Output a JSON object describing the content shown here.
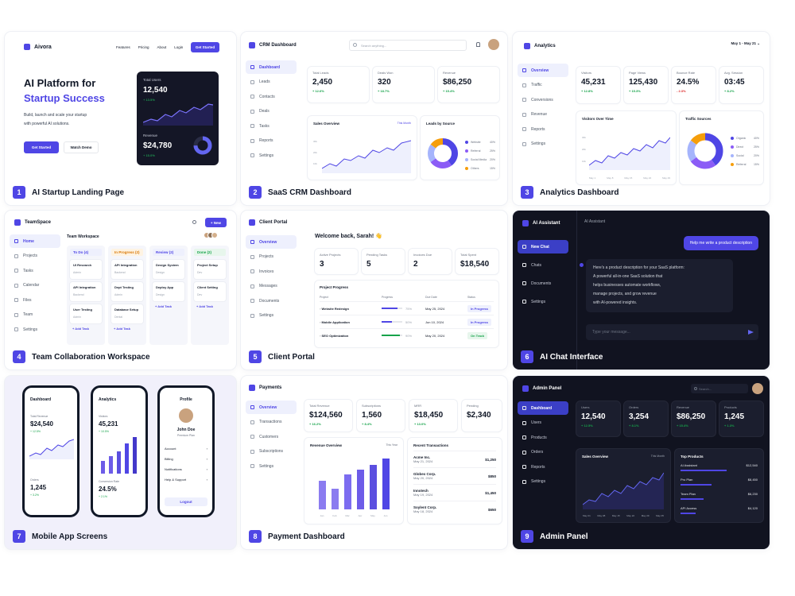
{
  "colors": {
    "accent": "#4f46e5",
    "green": "#16a34a",
    "red": "#dc2626",
    "dark_bg": "#111320"
  },
  "card1": {
    "caption_num": "1",
    "caption": "AI Startup Landing Page",
    "brand": "Aivora",
    "nav": [
      "Features",
      "Pricing",
      "About",
      "Login"
    ],
    "nav_cta": "Get Started",
    "hero_line1": "AI Platform for",
    "hero_line2": "Startup Success",
    "sub1": "Build, launch and scale your startup",
    "sub2": "with powerful AI solutions.",
    "cta_primary": "Get Started",
    "cta_secondary": "Watch Demo",
    "widget": {
      "users_label": "Total Users",
      "users_value": "12,540",
      "users_delta": "+ 13.5%",
      "rev_label": "Revenue",
      "rev_value": "$24,780",
      "rev_delta": "+ 15.0%"
    }
  },
  "card2": {
    "caption_num": "2",
    "caption": "SaaS CRM Dashboard",
    "title": "CRM Dashboard",
    "search_placeholder": "Search anything...",
    "nav": [
      "Dashboard",
      "Leads",
      "Contacts",
      "Deals",
      "Tasks",
      "Reports",
      "Settings"
    ],
    "stats": [
      {
        "label": "Total Leads",
        "value": "2,450",
        "delta": "+ 12.6%"
      },
      {
        "label": "Deals Won",
        "value": "320",
        "delta": "+ 18.7%"
      },
      {
        "label": "Revenue",
        "value": "$86,250",
        "delta": "+ 15.4%"
      }
    ],
    "sales_title": "Sales Overview",
    "sales_period": "This Month",
    "sales_y": [
      "30k",
      "20k",
      "10k"
    ],
    "leads_title": "Leads by Source",
    "legend": [
      {
        "name": "Website",
        "pct": "40%",
        "color": "#4f46e5"
      },
      {
        "name": "Referral",
        "pct": "25%",
        "color": "#8b5cf6"
      },
      {
        "name": "Social Media",
        "pct": "20%",
        "color": "#a5b4fc"
      },
      {
        "name": "Others",
        "pct": "15%",
        "color": "#f59e0b"
      }
    ]
  },
  "card3": {
    "caption_num": "3",
    "caption": "Analytics Dashboard",
    "title": "Analytics",
    "date_range": "May 1 - May 21",
    "nav": [
      "Overview",
      "Traffic",
      "Conversions",
      "Revenue",
      "Reports",
      "Settings"
    ],
    "stats": [
      {
        "label": "Visitors",
        "value": "45,231",
        "delta": "+ 12.8%",
        "neg": false
      },
      {
        "label": "Page Views",
        "value": "125,430",
        "delta": "+ 15.3%",
        "neg": false
      },
      {
        "label": "Bounce Rate",
        "value": "24.5%",
        "delta": "- 2.3%",
        "neg": true
      },
      {
        "label": "Avg. Session",
        "value": "03:45",
        "delta": "+ 8.2%",
        "neg": false
      }
    ],
    "visitors_title": "Visitors Over Time",
    "visitors_y": [
      "30k",
      "20k",
      "10k"
    ],
    "visitors_x": [
      "May 1",
      "May 8",
      "May 15",
      "May 22",
      "May 29"
    ],
    "traffic_title": "Traffic Sources",
    "legend": [
      {
        "name": "Organic",
        "pct": "40%",
        "color": "#4f46e5"
      },
      {
        "name": "Direct",
        "pct": "25%",
        "color": "#8b5cf6"
      },
      {
        "name": "Social",
        "pct": "20%",
        "color": "#a5b4fc"
      },
      {
        "name": "Referral",
        "pct": "15%",
        "color": "#f59e0b"
      }
    ]
  },
  "card4": {
    "caption_num": "4",
    "caption": "Team Collaboration Workspace",
    "brand": "TeamSpace",
    "new_btn": "+ New",
    "workspace_title": "Team Workspace",
    "nav": [
      "Home",
      "Projects",
      "Tasks",
      "Calendar",
      "Files",
      "Team",
      "Settings"
    ],
    "columns": [
      {
        "title": "To Do (4)",
        "color": "#4f46e5",
        "bg": "#eef0fd",
        "tasks": [
          {
            "t": "UI Research",
            "s": "Admin"
          },
          {
            "t": "API Integration",
            "s": "Backend"
          },
          {
            "t": "User Testing",
            "s": "Admin"
          }
        ],
        "add": "+ Add Task"
      },
      {
        "title": "In Progress (2)",
        "color": "#d97706",
        "bg": "#fef3e2",
        "tasks": [
          {
            "t": "API Integration",
            "s": "Backend"
          },
          {
            "t": "Dept Testing",
            "s": "Admin"
          },
          {
            "t": "Database Setup",
            "s": "Dental"
          }
        ],
        "add": "+ Add Task"
      },
      {
        "title": "Review (2)",
        "color": "#4f46e5",
        "bg": "#eef0fd",
        "tasks": [
          {
            "t": "Design System",
            "s": "Design"
          },
          {
            "t": "Deploy App",
            "s": "Design"
          }
        ],
        "add": "+ Add Task"
      },
      {
        "title": "Done (2)",
        "color": "#16a34a",
        "bg": "#e7f6ec",
        "tasks": [
          {
            "t": "Project Setup",
            "s": "Dev"
          },
          {
            "t": "Client Setting",
            "s": "Dev"
          }
        ],
        "add": "+ Add Task"
      }
    ]
  },
  "card5": {
    "caption_num": "5",
    "caption": "Client Portal",
    "brand": "Client Portal",
    "welcome": "Welcome back, Sarah! 👋",
    "nav": [
      "Overview",
      "Projects",
      "Invoices",
      "Messages",
      "Documents",
      "Settings"
    ],
    "stats": [
      {
        "label": "Active Projects",
        "value": "3"
      },
      {
        "label": "Pending Tasks",
        "value": "5"
      },
      {
        "label": "Invoices Due",
        "value": "2"
      },
      {
        "label": "Total Spent",
        "value": "$18,540"
      }
    ],
    "progress_title": "Project Progress",
    "headers": [
      "Project",
      "Progress",
      "Due Date",
      "Status"
    ],
    "rows": [
      {
        "name": "Website Redesign",
        "pct": "75%",
        "pv": 75,
        "due": "May 25, 2024",
        "status": "In Progress",
        "c": "#4f46e5"
      },
      {
        "name": "Mobile Application",
        "pct": "50%",
        "pv": 50,
        "due": "Jun 10, 2024",
        "status": "In Progress",
        "c": "#4f46e5"
      },
      {
        "name": "SEO Optimization",
        "pct": "90%",
        "pv": 90,
        "due": "May 20, 2024",
        "status": "On Track",
        "c": "#16a34a"
      }
    ]
  },
  "card6": {
    "caption_num": "6",
    "caption": "AI Chat Interface",
    "brand": "AI Assistant",
    "header": "AI Assistant",
    "nav": [
      "New Chat",
      "Chats",
      "Documents",
      "Settings"
    ],
    "user_msg": "Help me write a product description",
    "bot_l1": "Here's a product description for your SaaS platform:",
    "bot_l2": "A powerful all-in-one SaaS solution that",
    "bot_l3": "helps businesses automate workflows,",
    "bot_l4": "manage projects, and grow revenue",
    "bot_l5": "with AI-powered insights.",
    "input_placeholder": "Type your message..."
  },
  "card7": {
    "caption_num": "7",
    "caption": "Mobile App Screens",
    "p1": {
      "title": "Dashboard",
      "rev_label": "Total Revenue",
      "rev_value": "$24,540",
      "rev_delta": "+ 12.5%",
      "orders_label": "Orders",
      "orders_value": "1,245",
      "orders_delta": "+ 3.2%"
    },
    "p2": {
      "title": "Analytics",
      "vis_label": "Visitors",
      "vis_value": "45,231",
      "vis_delta": "+ 10.5%",
      "conv_label": "Conversion Rate",
      "conv_value": "24.5%",
      "conv_delta": "+ 2.1%"
    },
    "p3": {
      "title": "Profile",
      "name": "John Doe",
      "role": "Premium Plan",
      "items": [
        "Account",
        "Billing",
        "Notifications",
        "Help & Support"
      ],
      "logout": "Logout"
    }
  },
  "card8": {
    "caption_num": "8",
    "caption": "Payment Dashboard",
    "brand": "Payments",
    "nav": [
      "Overview",
      "Transactions",
      "Customers",
      "Subscriptions",
      "Settings"
    ],
    "stats": [
      {
        "label": "Total Revenue",
        "value": "$124,560",
        "delta": "+ 16.2%"
      },
      {
        "label": "Subscriptions",
        "value": "1,560",
        "delta": "+ 8.4%"
      },
      {
        "label": "MRR",
        "value": "$18,450",
        "delta": "+ 13.0%"
      },
      {
        "label": "Pending",
        "value": "$2,340",
        "delta": ""
      }
    ],
    "rev_title": "Revenue Overview",
    "rev_period": "This Year",
    "months": [
      "Jan",
      "Feb",
      "Mar",
      "Apr",
      "May",
      "Jun"
    ],
    "tx_title": "Recent Transactions",
    "tx": [
      {
        "name": "Acme Inc.",
        "date": "May 21, 2024",
        "amt": "$1,250"
      },
      {
        "name": "Globex Corp.",
        "date": "May 20, 2024",
        "amt": "$850"
      },
      {
        "name": "Innotech",
        "date": "May 19, 2024",
        "amt": "$1,450"
      },
      {
        "name": "Soylent Corp.",
        "date": "May 18, 2024",
        "amt": "$650"
      }
    ]
  },
  "card9": {
    "caption_num": "9",
    "caption": "Admin Panel",
    "brand": "Admin Panel",
    "search_placeholder": "Search...",
    "nav": [
      "Dashboard",
      "Users",
      "Products",
      "Orders",
      "Reports",
      "Settings"
    ],
    "stats": [
      {
        "label": "Users",
        "value": "12,540",
        "delta": "+ 12.5%"
      },
      {
        "label": "Orders",
        "value": "3,254",
        "delta": "+ 8.1%"
      },
      {
        "label": "Revenue",
        "value": "$86,250",
        "delta": "+ 15.4%"
      },
      {
        "label": "Products",
        "value": "1,245",
        "delta": "+ 1.3%"
      }
    ],
    "sales_title": "Sales Overview",
    "sales_period": "This Month",
    "sales_x": [
      "May 01",
      "May 08",
      "May 15",
      "May 22",
      "May 29",
      "May 05"
    ],
    "top_title": "Top Products",
    "products": [
      {
        "name": "AI Assistant",
        "value": "$12,540"
      },
      {
        "name": "Pro Plan",
        "value": "$8,450"
      },
      {
        "name": "Team Plan",
        "value": "$6,230"
      },
      {
        "name": "API Access",
        "value": "$4,120"
      }
    ]
  }
}
